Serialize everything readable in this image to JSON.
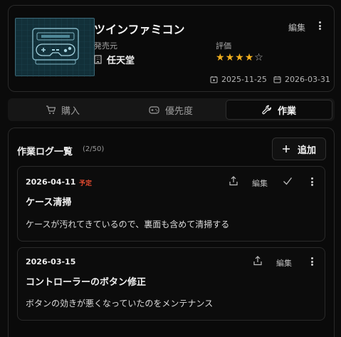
{
  "item": {
    "title": "ツインファミコン",
    "edit_label": "編集",
    "maker_label": "発売元",
    "maker": "任天堂",
    "rating_label": "評価",
    "rating": 4,
    "rating_max": 5,
    "date_added": "2025-11-25",
    "date_updated": "2026-03-31"
  },
  "tabs": [
    {
      "label": "購入",
      "icon": "cart-icon",
      "active": false
    },
    {
      "label": "優先度",
      "icon": "gamepad-icon",
      "active": false
    },
    {
      "label": "作業",
      "icon": "wrench-icon",
      "active": true
    }
  ],
  "worklog": {
    "title": "作業ログ一覧",
    "count": "(2/50)",
    "add_label": "追加",
    "entries": [
      {
        "date": "2026-04-11",
        "badge": "予定",
        "title": "ケース清掃",
        "body": "ケースが汚れてきているので、裏面も含めて清掃する",
        "edit_label": "編集"
      },
      {
        "date": "2026-03-15",
        "title": "コントローラーのボタン修正",
        "body": "ボタンの効きが悪くなっていたのをメンテナンス",
        "edit_label": "編集"
      }
    ]
  },
  "colors": {
    "accent_star": "#f2b01e",
    "badge_red": "#e0492f",
    "thumb_bg": "#123039"
  }
}
